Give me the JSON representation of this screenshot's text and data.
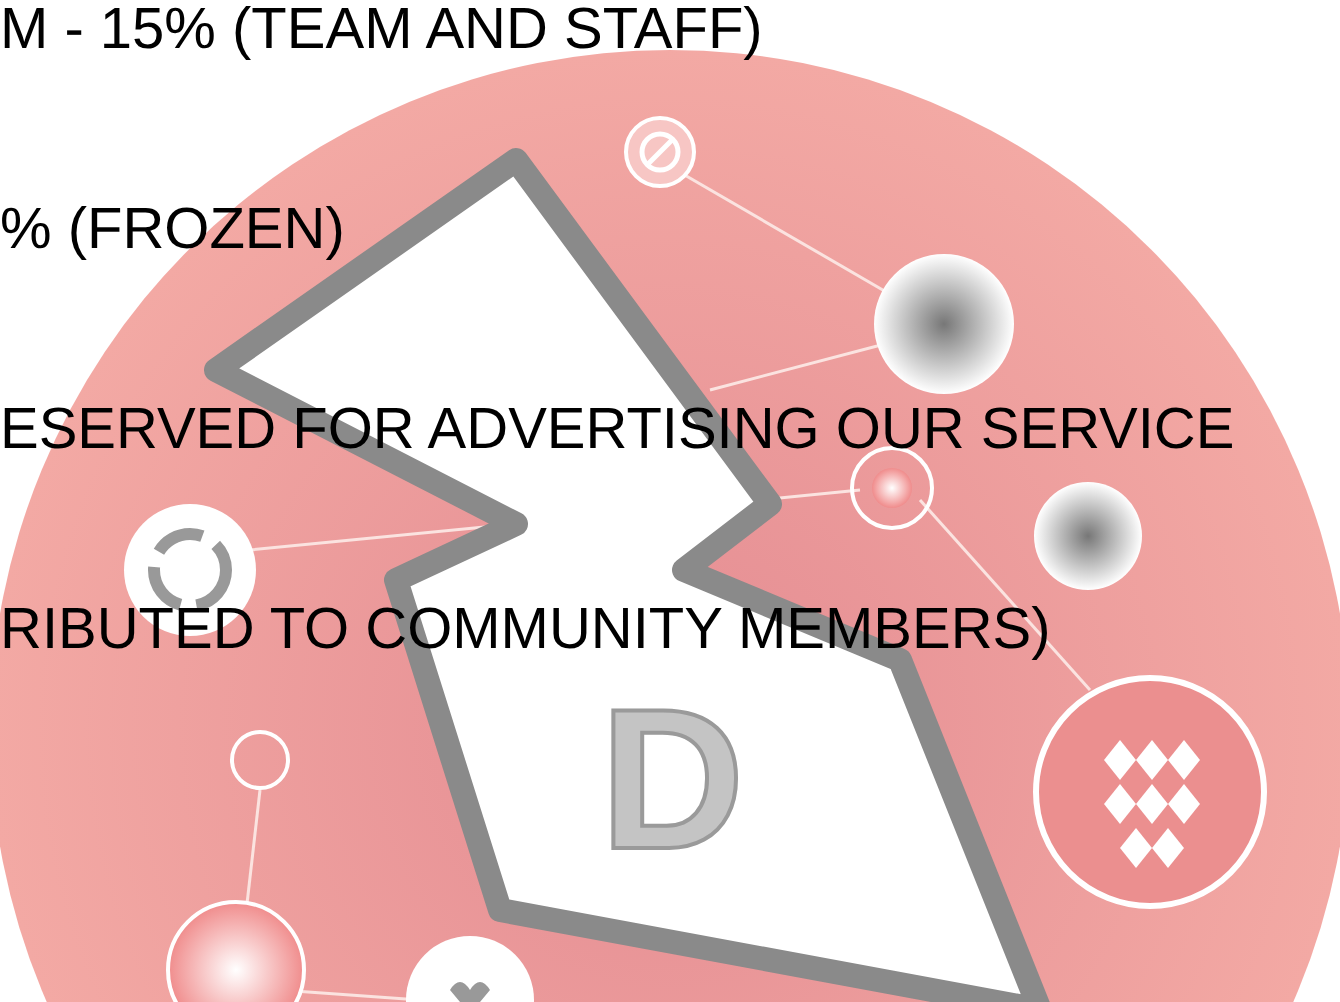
{
  "lines": [
    "M - 15% (TEAM AND STAFF)",
    "% (FROZEN)",
    "ESERVED FOR ADVERTISING OUR SERVICE",
    "RIBUTED TO COMMUNITY MEMBERS)"
  ],
  "emblem": {
    "letter": "D"
  }
}
